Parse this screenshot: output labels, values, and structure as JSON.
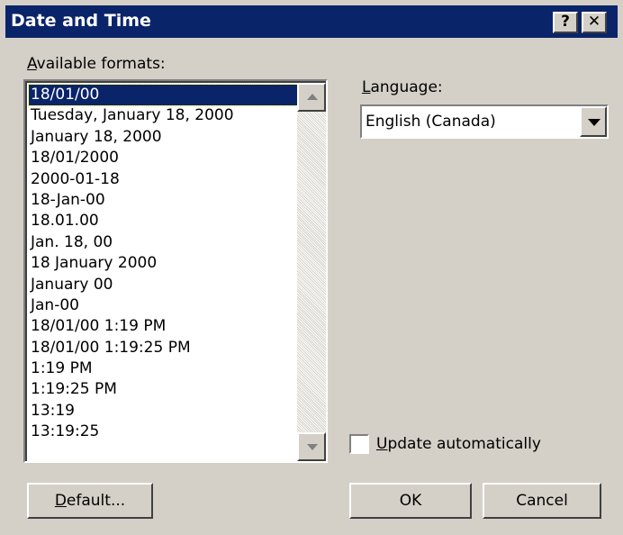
{
  "window": {
    "title": "Date and Time",
    "help_glyph": "?",
    "close_glyph": "✕"
  },
  "formats": {
    "label_mnemonic": "A",
    "label_rest": "vailable formats:",
    "selected_index": 0,
    "items": [
      "18/01/00",
      "Tuesday, January 18, 2000",
      "January 18, 2000",
      "18/01/2000",
      "2000-01-18",
      "18-Jan-00",
      "18.01.00",
      "Jan. 18, 00",
      "18 January 2000",
      "January 00",
      "Jan-00",
      "18/01/00 1:19 PM",
      "18/01/00 1:19:25 PM",
      "1:19 PM",
      "1:19:25 PM",
      "13:19",
      "13:19:25"
    ]
  },
  "language": {
    "label_mnemonic": "L",
    "label_rest": "anguage:",
    "selected": "English (Canada)"
  },
  "update": {
    "label_mnemonic": "U",
    "label_rest": "pdate automatically",
    "checked": false
  },
  "buttons": {
    "default_mnemonic": "D",
    "default_rest": "efault...",
    "ok": "OK",
    "cancel": "Cancel"
  },
  "colors": {
    "dialog_face": "#d4d0c8",
    "title_bar": "#0a246a",
    "selection": "#0a246a"
  }
}
